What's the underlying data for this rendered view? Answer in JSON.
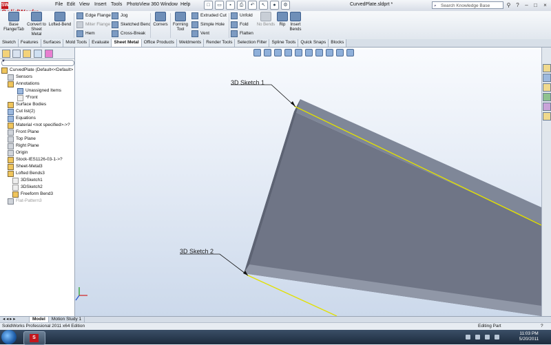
{
  "app": {
    "logo": "SolidWorks",
    "doc_title": "CurvedPlate.sldprt *"
  },
  "menu": [
    "File",
    "Edit",
    "View",
    "Insert",
    "Tools",
    "PhotoView 360",
    "Window",
    "Help"
  ],
  "search": {
    "placeholder": "Search Knowledge Base"
  },
  "ribbon": {
    "base_flange": "Base Flange/Tab",
    "convert": "Convert to Sheet Metal",
    "lofted_bend": "Lofted-Bend",
    "edge_flange": "Edge Flange",
    "miter_flange": "Miter Flange",
    "hem": "Hem",
    "jog": "Jog",
    "sketched_bend": "Sketched Bend",
    "cross_break": "Cross-Break",
    "corners": "Corners",
    "forming_tool": "Forming Tool",
    "extruded_cut": "Extruded Cut",
    "simple_hole": "Simple Hole",
    "vent": "Vent",
    "unfold": "Unfold",
    "fold": "Fold",
    "flatten": "Flatten",
    "no_bends": "No Bends",
    "rip": "Rip",
    "insert_bends": "Insert Bends"
  },
  "tabs": [
    "Sketch",
    "Features",
    "Surfaces",
    "Mold Tools",
    "Evaluate",
    "Sheet Metal",
    "Office Products",
    "Weldments",
    "Render Tools",
    "Selection Filter",
    "Spline Tools",
    "Quick Snaps",
    "Blocks"
  ],
  "active_tab": "Sheet Metal",
  "tree": {
    "root": "CurvedPlate  (Default<<Default>",
    "items": [
      {
        "label": "Sensors",
        "indent": 1
      },
      {
        "label": "Annotations",
        "indent": 1
      },
      {
        "label": "Unassigned Items",
        "indent": 3
      },
      {
        "label": "*Front",
        "indent": 3
      },
      {
        "label": "Surface Bodies",
        "indent": 1
      },
      {
        "label": "Cut list(2)",
        "indent": 1
      },
      {
        "label": "Equations",
        "indent": 1
      },
      {
        "label": "Material <not specified>->?",
        "indent": 1
      },
      {
        "label": "Front Plane",
        "indent": 1
      },
      {
        "label": "Top Plane",
        "indent": 1
      },
      {
        "label": "Right Plane",
        "indent": 1
      },
      {
        "label": "Origin",
        "indent": 1
      },
      {
        "label": "Stock-IES1126-03-1->?",
        "indent": 1
      },
      {
        "label": "Sheet-Metal3",
        "indent": 1
      },
      {
        "label": "Lofted Bends3",
        "indent": 1
      },
      {
        "label": "3DSketch1",
        "indent": 2
      },
      {
        "label": "3DSketch2",
        "indent": 2
      },
      {
        "label": "Freeform Bend3",
        "indent": 2
      },
      {
        "label": "Flat-Pattern3",
        "indent": 1,
        "dim": true
      }
    ]
  },
  "viewport": {
    "callout1": "3D Sketch 1",
    "callout2": "3D Sketch 2"
  },
  "bottom_tabs": [
    "Model",
    "Motion Study 1"
  ],
  "status": {
    "left": "SolidWorks Professional 2011 x64 Edition",
    "right": "Editing Part"
  },
  "clock": {
    "time": "11:03 PM",
    "date": "5/20/2011"
  }
}
